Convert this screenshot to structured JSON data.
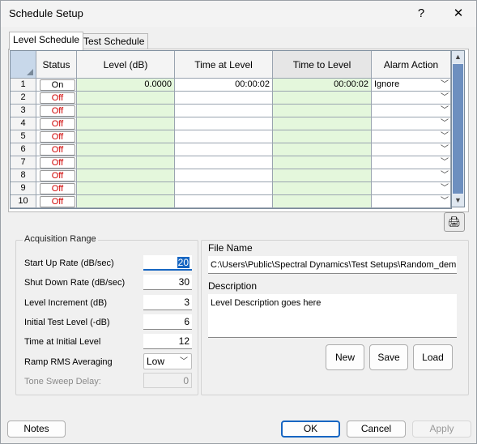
{
  "window": {
    "title": "Schedule Setup",
    "help_glyph": "?",
    "close_glyph": "✕"
  },
  "tabs": [
    {
      "label": "Level Schedule",
      "active": true
    },
    {
      "label": "Test Schedule",
      "active": false
    }
  ],
  "grid": {
    "columns": [
      "Status",
      "Level (dB)",
      "Time at Level",
      "Time to Level",
      "Alarm Action"
    ],
    "rows": [
      {
        "num": "1",
        "status": "On",
        "level": "0.0000",
        "time_at_level": "00:00:02",
        "time_to_level": "00:00:02",
        "alarm": "Ignore"
      },
      {
        "num": "2",
        "status": "Off",
        "level": "",
        "time_at_level": "",
        "time_to_level": "",
        "alarm": ""
      },
      {
        "num": "3",
        "status": "Off",
        "level": "",
        "time_at_level": "",
        "time_to_level": "",
        "alarm": ""
      },
      {
        "num": "4",
        "status": "Off",
        "level": "",
        "time_at_level": "",
        "time_to_level": "",
        "alarm": ""
      },
      {
        "num": "5",
        "status": "Off",
        "level": "",
        "time_at_level": "",
        "time_to_level": "",
        "alarm": ""
      },
      {
        "num": "6",
        "status": "Off",
        "level": "",
        "time_at_level": "",
        "time_to_level": "",
        "alarm": ""
      },
      {
        "num": "7",
        "status": "Off",
        "level": "",
        "time_at_level": "",
        "time_to_level": "",
        "alarm": ""
      },
      {
        "num": "8",
        "status": "Off",
        "level": "",
        "time_at_level": "",
        "time_to_level": "",
        "alarm": ""
      },
      {
        "num": "9",
        "status": "Off",
        "level": "",
        "time_at_level": "",
        "time_to_level": "",
        "alarm": ""
      },
      {
        "num": "10",
        "status": "Off",
        "level": "",
        "time_at_level": "",
        "time_to_level": "",
        "alarm": ""
      }
    ]
  },
  "acquisition": {
    "title": "Acquisition Range",
    "fields": [
      {
        "label": "Start Up Rate (dB/sec)",
        "value": "20"
      },
      {
        "label": "Shut Down Rate (dB/sec)",
        "value": "30"
      },
      {
        "label": "Level Increment (dB)",
        "value": "3"
      },
      {
        "label": "Initial Test Level (-dB)",
        "value": "6"
      },
      {
        "label": "Time at Initial Level",
        "value": "12"
      }
    ],
    "ramp_label": "Ramp RMS Averaging",
    "ramp_value": "Low",
    "tone_label": "Tone Sweep Delay:",
    "tone_value": "0"
  },
  "file": {
    "name_label": "File Name",
    "name_value": "C:\\Users\\Public\\Spectral Dynamics\\Test Setups\\Random_dem",
    "desc_label": "Description",
    "desc_value": "Level Description goes here",
    "buttons": {
      "new": "New",
      "save": "Save",
      "load": "Load"
    }
  },
  "footer": {
    "notes": "Notes",
    "ok": "OK",
    "cancel": "Cancel",
    "apply": "Apply"
  },
  "icons": {
    "print": "printer-icon",
    "chevron": "chevron-down-icon"
  },
  "colors": {
    "green_cell": "#e4f7dc",
    "off_red": "#d00000",
    "accent_blue": "#1766c2",
    "scroll_thumb": "#6d8fbf"
  }
}
